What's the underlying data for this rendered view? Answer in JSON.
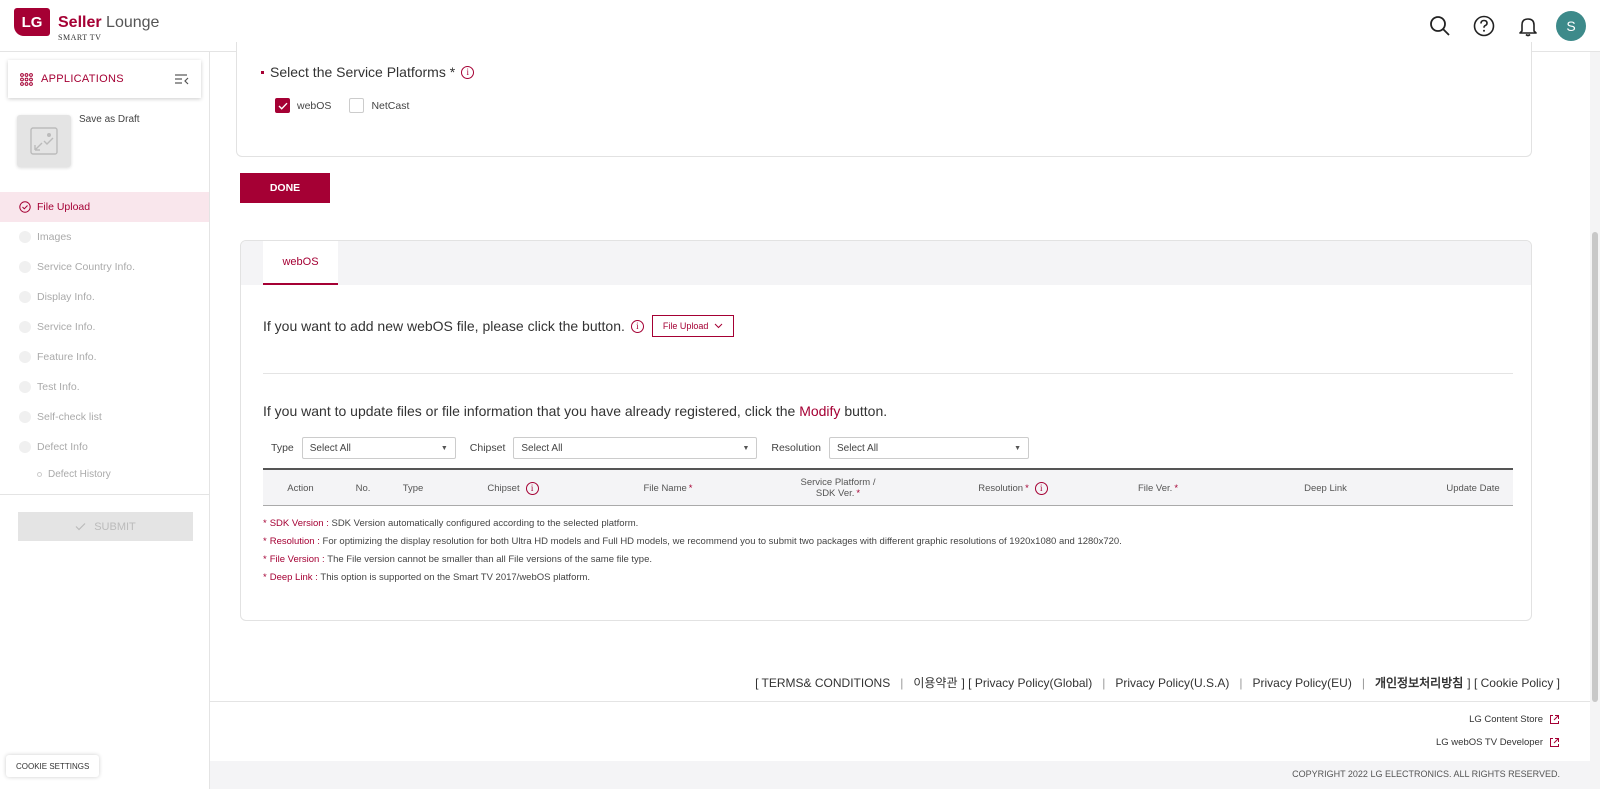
{
  "header": {
    "logo_badge": "LG",
    "brand_bold": "Seller",
    "brand_light": "Lounge",
    "brand_sub": "SMART TV",
    "avatar_initial": "S",
    "accent_color": "#a50034"
  },
  "sidebar": {
    "apps_label": "APPLICATIONS",
    "draft_label": "Save as Draft",
    "items": [
      {
        "label": "File Upload",
        "state": "active"
      },
      {
        "label": "Images"
      },
      {
        "label": "Service Country Info."
      },
      {
        "label": "Display Info."
      },
      {
        "label": "Service Info."
      },
      {
        "label": "Feature Info."
      },
      {
        "label": "Test Info."
      },
      {
        "label": "Self-check list"
      },
      {
        "label": "Defect Info"
      }
    ],
    "sub_item": "Defect History",
    "submit_label": "SUBMIT",
    "cookie_label": "COOKIE SETTINGS"
  },
  "platforms": {
    "title": "Select the Service Platforms",
    "required_mark": "*",
    "options": [
      {
        "label": "webOS",
        "checked": true
      },
      {
        "label": "NetCast",
        "checked": false
      }
    ]
  },
  "done_label": "DONE",
  "panel": {
    "tab_label": "webOS",
    "add_text": "If you want to add new webOS file, please click the button.",
    "file_upload_label": "File Upload",
    "update_text_before": "If you want to update files or file information that you have already registered, click the",
    "modify_word": "Modify",
    "update_text_after": "button.",
    "filters": {
      "type_label": "Type",
      "type_value": "Select All",
      "chipset_label": "Chipset",
      "chipset_value": "Select All",
      "resolution_label": "Resolution",
      "resolution_value": "Select All"
    },
    "columns": {
      "action": "Action",
      "no": "No.",
      "type": "Type",
      "chipset": "Chipset",
      "file_name": "File Name",
      "service_platform_1": "Service Platform /",
      "service_platform_2": "SDK Ver.",
      "resolution": "Resolution",
      "file_ver": "File Ver.",
      "deep_link": "Deep Link",
      "update_date": "Update Date",
      "required_mark": "*"
    },
    "notes": [
      {
        "key": "SDK Version :",
        "text": "SDK Version automatically configured according to the selected platform."
      },
      {
        "key": "Resolution :",
        "text": "For optimizing the display resolution for both Ultra HD models and Full HD models, we recommend you to submit two packages with different graphic resolutions of 1920x1080 and 1280x720."
      },
      {
        "key": "File Version :",
        "text": "The File version cannot be smaller than all File versions of the same file type."
      },
      {
        "key": "Deep Link :",
        "text": "This option is supported on the Smart TV 2017/webOS platform."
      }
    ]
  },
  "footer": {
    "terms": "[ TERMS& CONDITIONS",
    "korean_terms": "이용약관",
    "privacy_global": "] [ Privacy Policy(Global)",
    "privacy_usa": "Privacy Policy(U.S.A)",
    "privacy_eu": "Privacy Policy(EU)",
    "korean_privacy": "개인정보처리방침",
    "cookie_policy": "] [ Cookie Policy ]",
    "sep": "|",
    "content_store": "LG Content Store",
    "webos_dev": "LG webOS TV Developer",
    "copyright": "COPYRIGHT 2022 LG ELECTRONICS. ALL RIGHTS RESERVED."
  }
}
